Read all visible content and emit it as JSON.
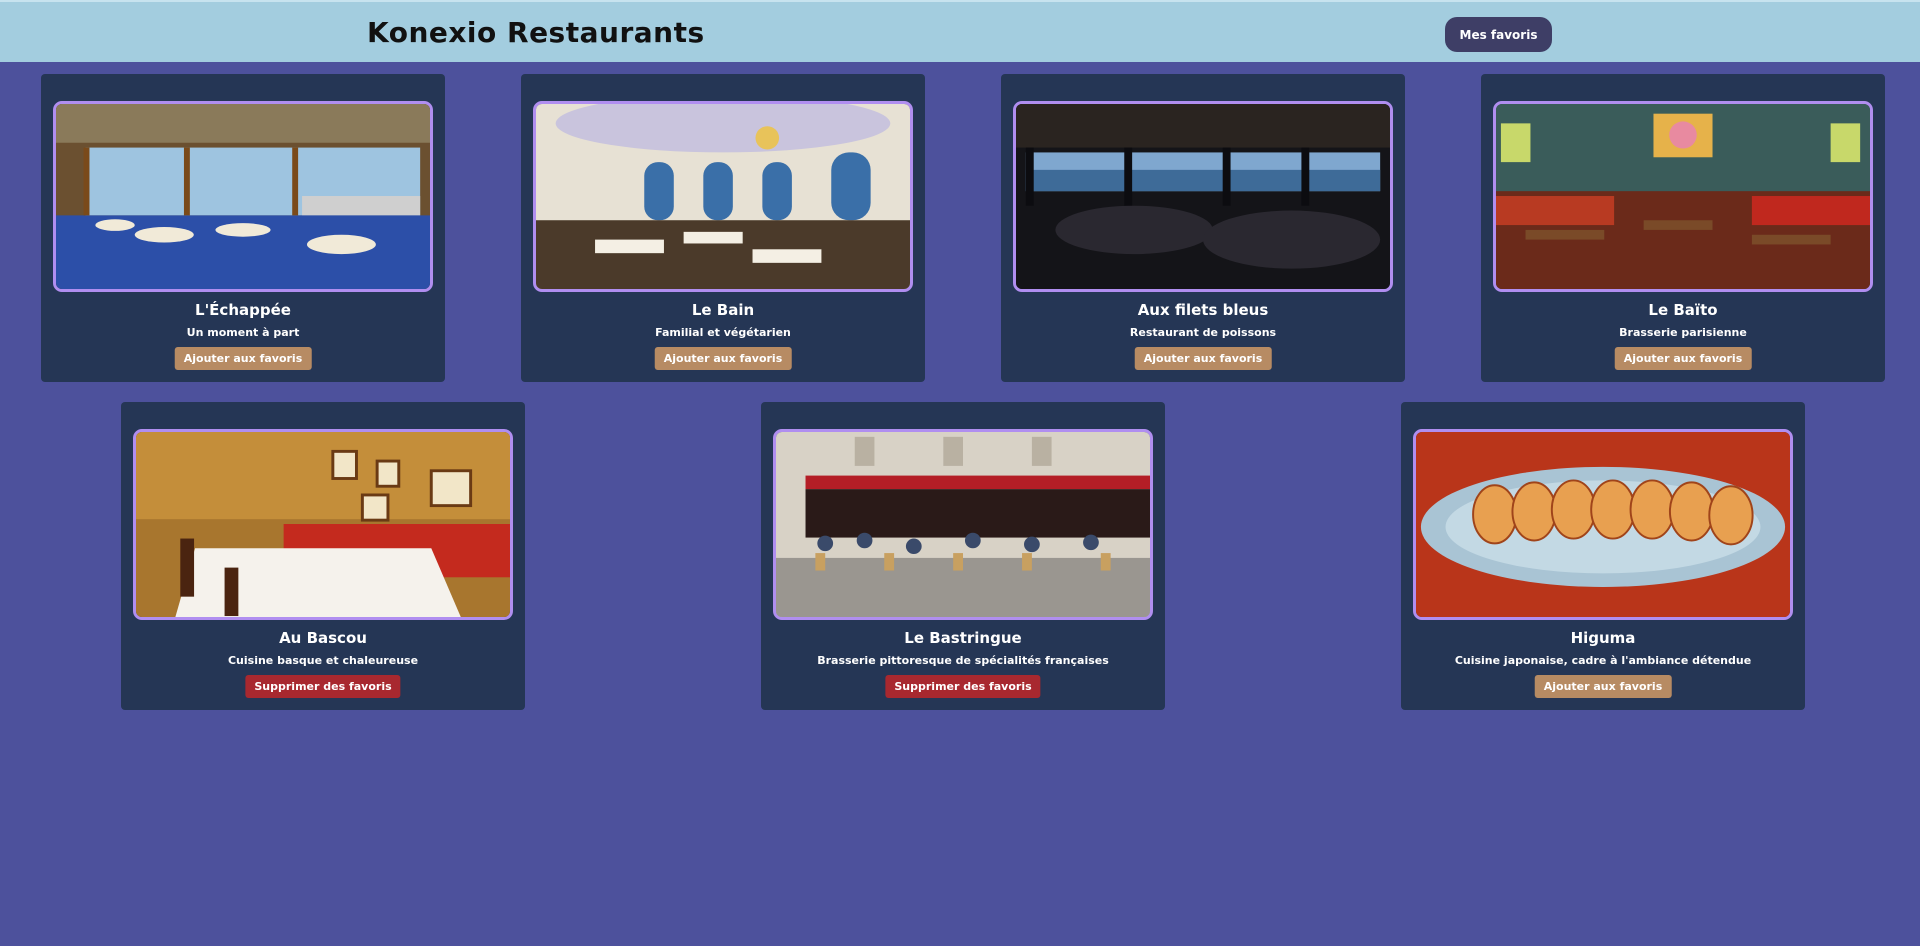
{
  "header": {
    "title": "Konexio Restaurants",
    "favorites_button": "Mes favoris"
  },
  "colors": {
    "background": "#4d519c",
    "header": "#a3cddf",
    "card": "#253655",
    "add_button": "#b78b63",
    "remove_button": "#a8282f",
    "photo_border": "#b08ef0"
  },
  "restaurants": [
    {
      "name": "L'Échappée",
      "description": "Un moment à part",
      "action": "Ajouter aux favoris",
      "favorite": false,
      "image": "panoramic-dining-room-photo"
    },
    {
      "name": "Le Bain",
      "description": "Familial et végétarien",
      "action": "Ajouter aux favoris",
      "favorite": false,
      "image": "chandelier-dining-room-photo"
    },
    {
      "name": "Aux filets bleus",
      "description": "Restaurant de poissons",
      "action": "Ajouter aux favoris",
      "favorite": false,
      "image": "seaside-dining-room-photo"
    },
    {
      "name": "Le Baïto",
      "description": "Brasserie parisienne",
      "action": "Ajouter aux favoris",
      "favorite": false,
      "image": "pop-art-brasserie-photo"
    },
    {
      "name": "Au Bascou",
      "description": "Cuisine basque et chaleureuse",
      "action": "Supprimer des favoris",
      "favorite": true,
      "image": "red-banquette-dining-photo"
    },
    {
      "name": "Le Bastringue",
      "description": "Brasserie pittoresque de spécialités françaises",
      "action": "Supprimer des favoris",
      "favorite": true,
      "image": "terrace-brasserie-photo"
    },
    {
      "name": "Higuma",
      "description": "Cuisine japonaise, cadre à l'ambiance détendue",
      "action": "Ajouter aux favoris",
      "favorite": false,
      "image": "gyoza-plate-photo"
    }
  ]
}
